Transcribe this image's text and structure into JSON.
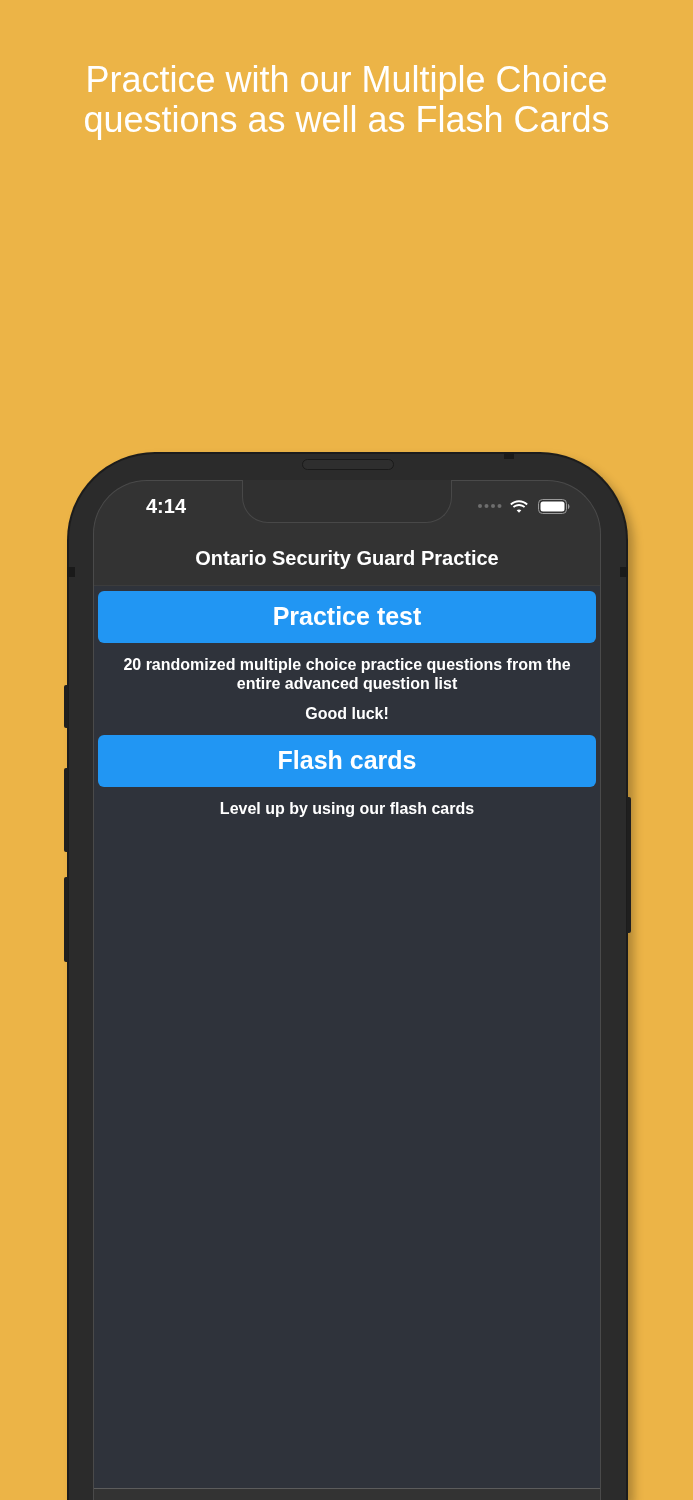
{
  "headline": "Practice with our Multiple Choice questions as well as Flash Cards",
  "status_bar": {
    "time": "4:14"
  },
  "nav": {
    "title": "Ontario Security Guard Practice"
  },
  "sections": [
    {
      "button": "Practice test",
      "notes": [
        "20 randomized multiple choice practice questions from the entire advanced question list",
        "Good luck!"
      ]
    },
    {
      "button": "Flash cards",
      "notes": [
        "Level up by using our flash cards"
      ]
    }
  ]
}
